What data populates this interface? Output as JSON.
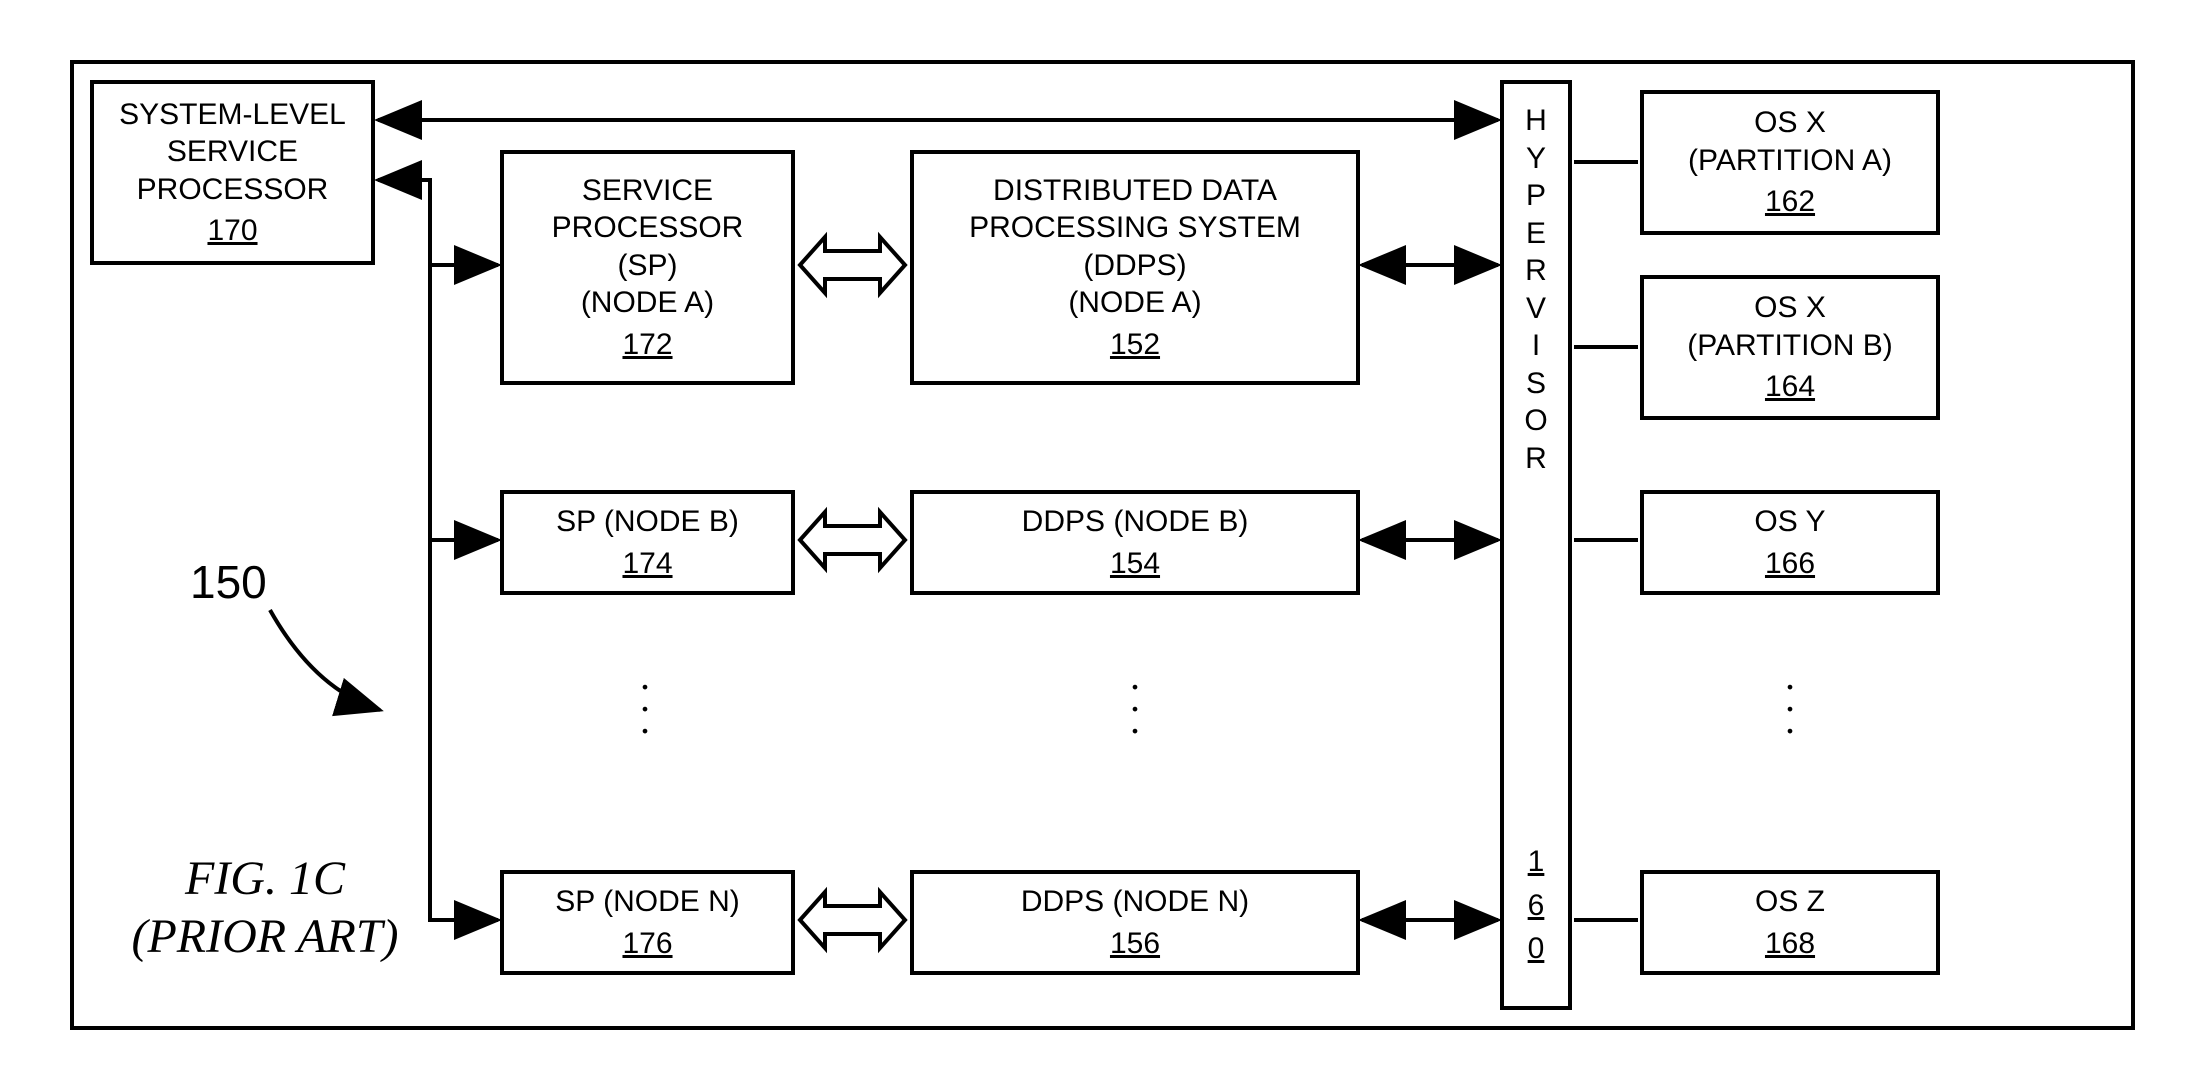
{
  "figure": {
    "title": "FIG. 1C",
    "subtitle": "(PRIOR ART)",
    "ref": "150"
  },
  "sys_sp": {
    "l1": "SYSTEM-LEVEL",
    "l2": "SERVICE",
    "l3": "PROCESSOR",
    "num": "170"
  },
  "sp_a": {
    "l1": "SERVICE",
    "l2": "PROCESSOR",
    "l3": "(SP)",
    "l4": "(NODE A)",
    "num": "172"
  },
  "ddps_a": {
    "l1": "DISTRIBUTED DATA",
    "l2": "PROCESSING SYSTEM",
    "l3": "(DDPS)",
    "l4": "(NODE A)",
    "num": "152"
  },
  "sp_b": {
    "l1": "SP (NODE B)",
    "num": "174"
  },
  "ddps_b": {
    "l1": "DDPS (NODE B)",
    "num": "154"
  },
  "sp_n": {
    "l1": "SP (NODE N)",
    "num": "176"
  },
  "ddps_n": {
    "l1": "DDPS (NODE N)",
    "num": "156"
  },
  "hyp": {
    "letters": [
      "H",
      "Y",
      "P",
      "E",
      "R",
      "V",
      "I",
      "S",
      "O",
      "R"
    ],
    "num_l1": "1",
    "num_l2": "6",
    "num_l3": "0"
  },
  "os_a": {
    "l1": "OS  X",
    "l2": "(PARTITION A)",
    "num": "162"
  },
  "os_b": {
    "l1": "OS  X",
    "l2": "(PARTITION B)",
    "num": "164"
  },
  "os_y": {
    "l1": "OS  Y",
    "num": "166"
  },
  "os_z": {
    "l1": "OS  Z",
    "num": "168"
  }
}
